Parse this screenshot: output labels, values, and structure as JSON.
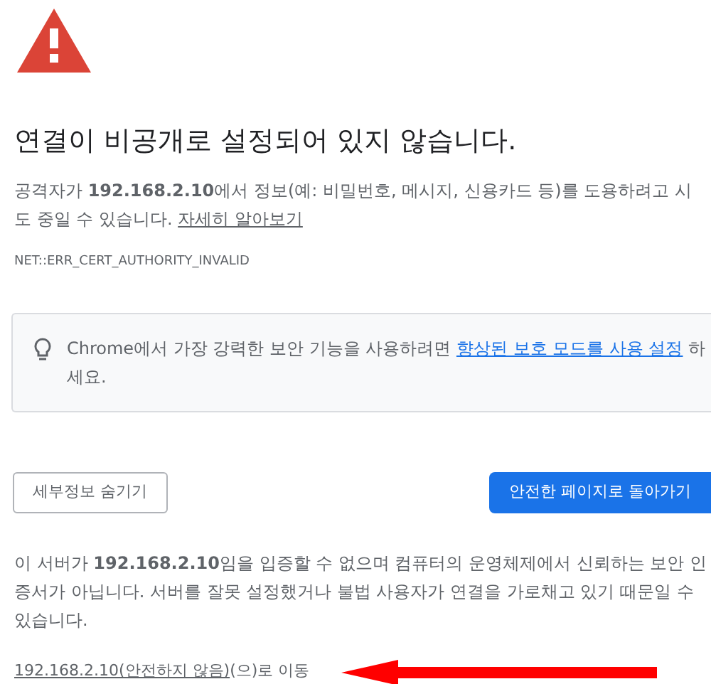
{
  "heading": "연결이 비공개로 설정되어 있지 않습니다.",
  "intro": {
    "text": "공격자가 **192.168.2.10**에서 정보(예: 비밀번호, 메시지, 신용카드 등)를 도용하려고 시도 중일 수 있습니다.",
    "link": "자세히 알아보기"
  },
  "error_code": "NET::ERR_CERT_AUTHORITY_INVALID",
  "tip": {
    "text": "Chrome에서 가장 강력한 보안 기능을 사용하려면",
    "link": "향상된 보호 모드를 사용 설정",
    "after": "하세요."
  },
  "buttons": [
    {
      "label": "세부정보 숨기기",
      "kind": "secondary"
    },
    {
      "label": "안전한 페이지로 돌아가기",
      "kind": "primary"
    }
  ],
  "details": "이 서버가 **192.168.2.10**임을 입증할 수 없으며 컴퓨터의 운영체제에서 신뢰하는 보안 인증서가 아닙니다. 서버를 잘못 설정했거나 불법 사용자가 연결을 가로채고 있기 때문일 수 있습니다.",
  "proceed": {
    "link": "192.168.2.10(안전하지 않음)",
    "after": "(으)로 이동"
  }
}
